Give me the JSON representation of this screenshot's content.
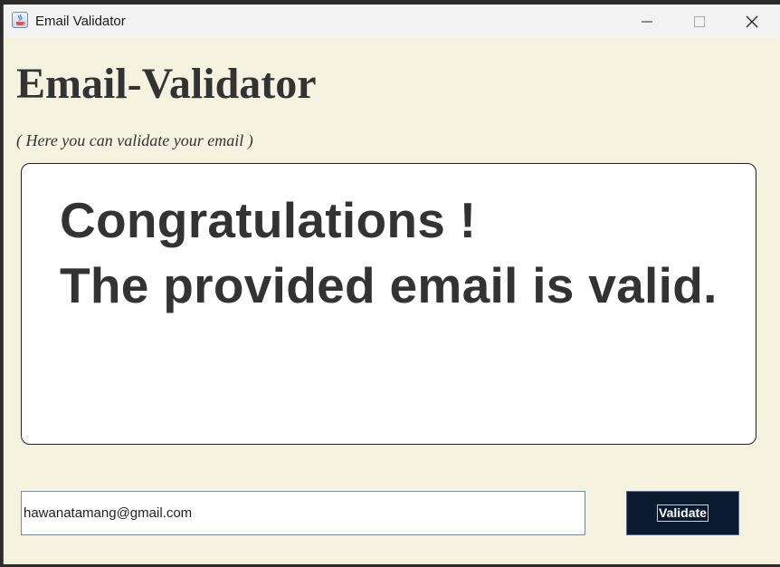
{
  "window": {
    "title": "Email Validator"
  },
  "app": {
    "heading": "Email-Validator",
    "subtitle": "( Here you can validate your email )"
  },
  "result": {
    "line1": "Congratulations !",
    "line2": "The provided email is valid."
  },
  "form": {
    "email_value": "hawanatamang@gmail.com",
    "validate_label": "Validate"
  },
  "colors": {
    "background": "#f5f3df",
    "text": "#333333",
    "button": "#0a1b30"
  }
}
